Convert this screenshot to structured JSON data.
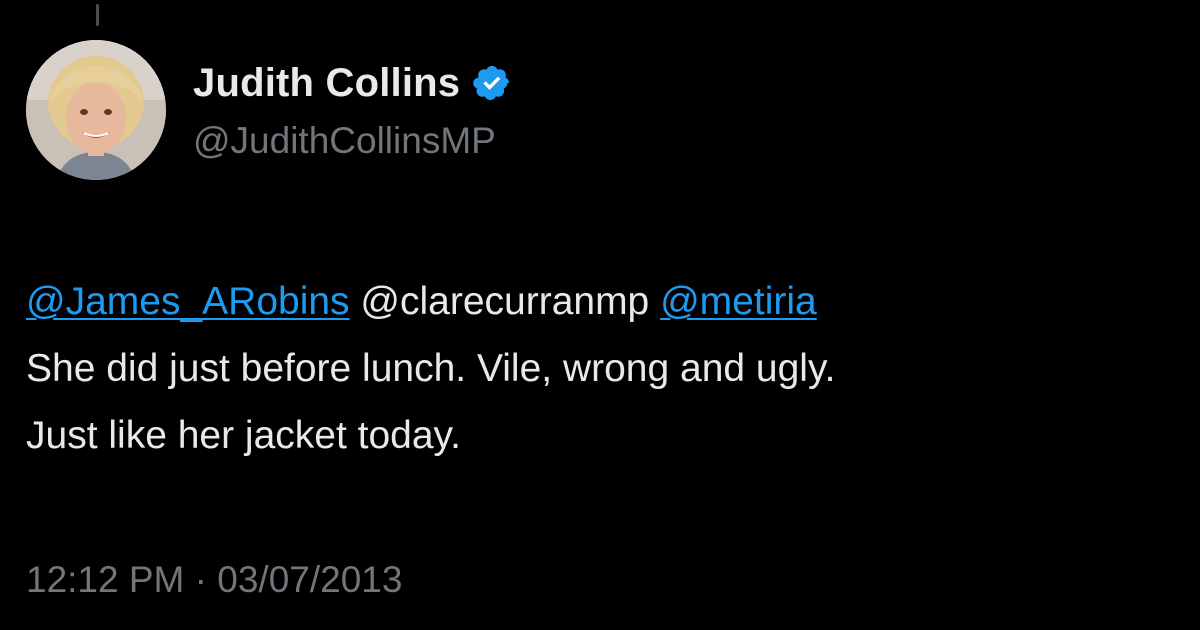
{
  "author": {
    "display_name": "Judith Collins",
    "handle": "@JudithCollinsMP",
    "verified": true,
    "avatar_icon": "profile-photo"
  },
  "tweet": {
    "mentions": [
      {
        "text": "@James_ARobins",
        "linked": true
      },
      {
        "text": "@clarecurranmp",
        "linked": false
      },
      {
        "text": "@metiria",
        "linked": true
      }
    ],
    "line2": "She did just before lunch. Vile, wrong and ugly.",
    "line3": "Just like her jacket today."
  },
  "meta": {
    "time": "12:12 PM",
    "separator": "·",
    "date": "03/07/2013"
  },
  "colors": {
    "background": "#000000",
    "text": "#e7e9ea",
    "muted": "#71767b",
    "link": "#1d9bf0"
  }
}
